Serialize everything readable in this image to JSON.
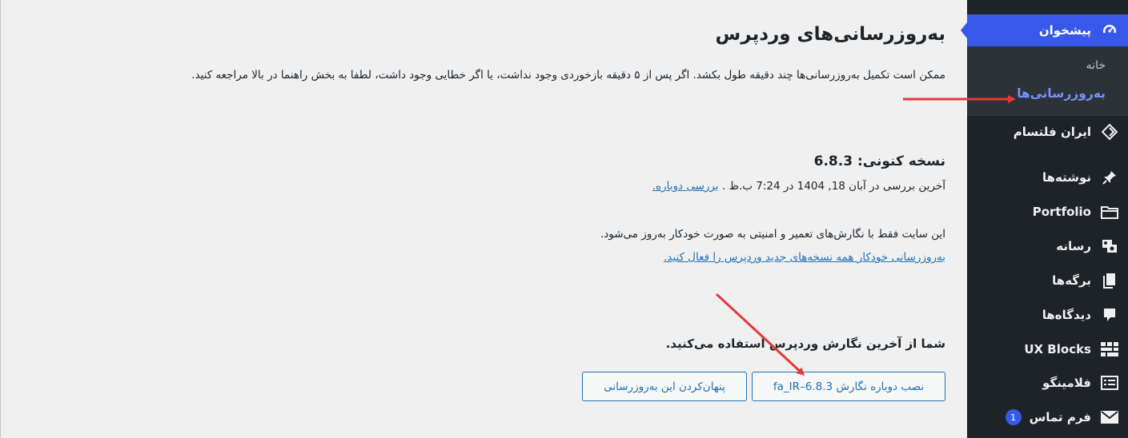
{
  "page": {
    "title": "به‌روزرسانی‌های وردپرس",
    "intro": "ممکن است تکمیل به‌روزرسانی‌ها چند دقیقه طول بکشد. اگر پس از ۵ دقیقه بازخوردی وجود نداشت، یا اگر خطایی وجود داشت، لطفا به بخش راهنما در بالا مراجعه کنید.",
    "version_title": "نسخه کنونی: 6.8.3",
    "last_check": "آخرین بررسی در آبان 18, 1404 در 7:24 ب.ظ .",
    "check_again": "بررسی دوباره.",
    "auto_info": "این سایت فقط با نگارش‌های تعمیر و امنیتی به صورت خودکار به‌روز می‌شود.",
    "auto_link": "به‌روزرسانی خودکار همه نسخه‌های جدید وردپرس را فعال کنید.",
    "latest_msg": "شما از آخرین نگارش وردپرس استفاده می‌کنید.",
    "reinstall_button": "نصب دوباره نگارش fa_IR–6.8.3",
    "hide_button": "پنهان‌کردن این به‌روزرسانی"
  },
  "sidebar": {
    "dashboard": {
      "label": "پیشخوان",
      "icon": "dashboard-icon"
    },
    "sub_home": "خانه",
    "sub_updates": "به‌روزرسانی‌ها",
    "items": [
      {
        "label": "ایران فلتسام",
        "icon": "diamond-icon"
      },
      {
        "label": "نوشته‌ها",
        "icon": "pin-icon"
      },
      {
        "label": "Portfolio",
        "icon": "folder-icon"
      },
      {
        "label": "رسانه",
        "icon": "media-icon"
      },
      {
        "label": "برگه‌ها",
        "icon": "pages-icon"
      },
      {
        "label": "دیدگاه‌ها",
        "icon": "comment-icon"
      },
      {
        "label": "UX Blocks",
        "icon": "blocks-icon"
      },
      {
        "label": "فلامینگو",
        "icon": "list-icon"
      },
      {
        "label": "فرم تماس",
        "icon": "mail-icon",
        "badge": "1"
      }
    ]
  },
  "colors": {
    "accent": "#3858e9",
    "sidebar_bg": "#1d2327",
    "link": "#2271b1",
    "arrow": "#e53935"
  }
}
